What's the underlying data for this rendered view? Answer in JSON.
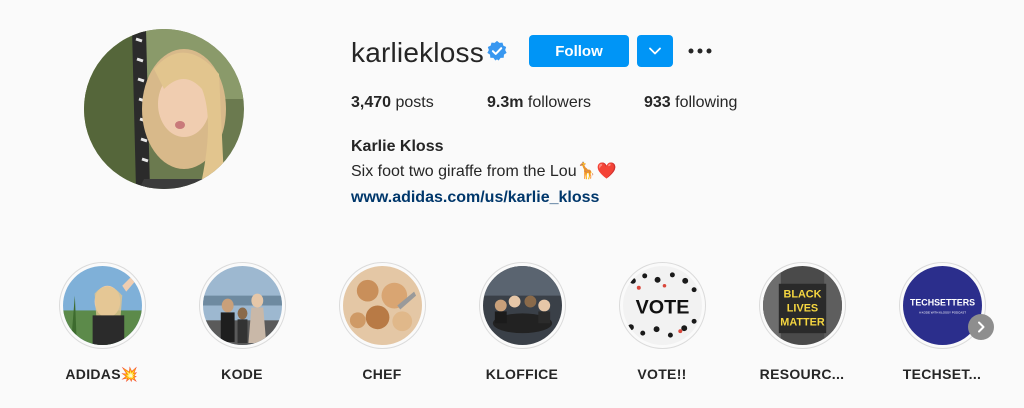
{
  "profile": {
    "username": "karliekloss",
    "verified": true,
    "follow_label": "Follow",
    "stats": {
      "posts_count": "3,470",
      "posts_label": "posts",
      "followers_count": "9.3m",
      "followers_label": "followers",
      "following_count": "933",
      "following_label": "following"
    },
    "full_name": "Karlie Kloss",
    "bio": "Six foot two giraffe from the Lou🦒❤️",
    "website": "www.adidas.com/us/karlie_kloss"
  },
  "highlights": [
    {
      "label": "ADIDAS💥"
    },
    {
      "label": "KODE"
    },
    {
      "label": "CHEF"
    },
    {
      "label": "KLOFFICE"
    },
    {
      "label": "VOTE!!"
    },
    {
      "label": "RESOURC..."
    },
    {
      "label": "TECHSET..."
    }
  ],
  "highlight_images": {
    "vote_text": "VOTE",
    "blm_line1": "BLACK",
    "blm_line2": "LIVES",
    "blm_line3": "MATTER",
    "techsetters_title": "TECHSETTERS",
    "techsetters_subtitle": "A KODE WITH KLOSSY PODCAST"
  },
  "colors": {
    "primary_button": "#0095f6",
    "link": "#00376b",
    "verified_badge": "#3897f0",
    "text": "#262626",
    "background": "#fafafa"
  },
  "icons": {
    "verified": "verified-badge-icon",
    "dropdown": "chevron-down-icon",
    "more": "more-options-icon",
    "next": "chevron-right-icon"
  }
}
